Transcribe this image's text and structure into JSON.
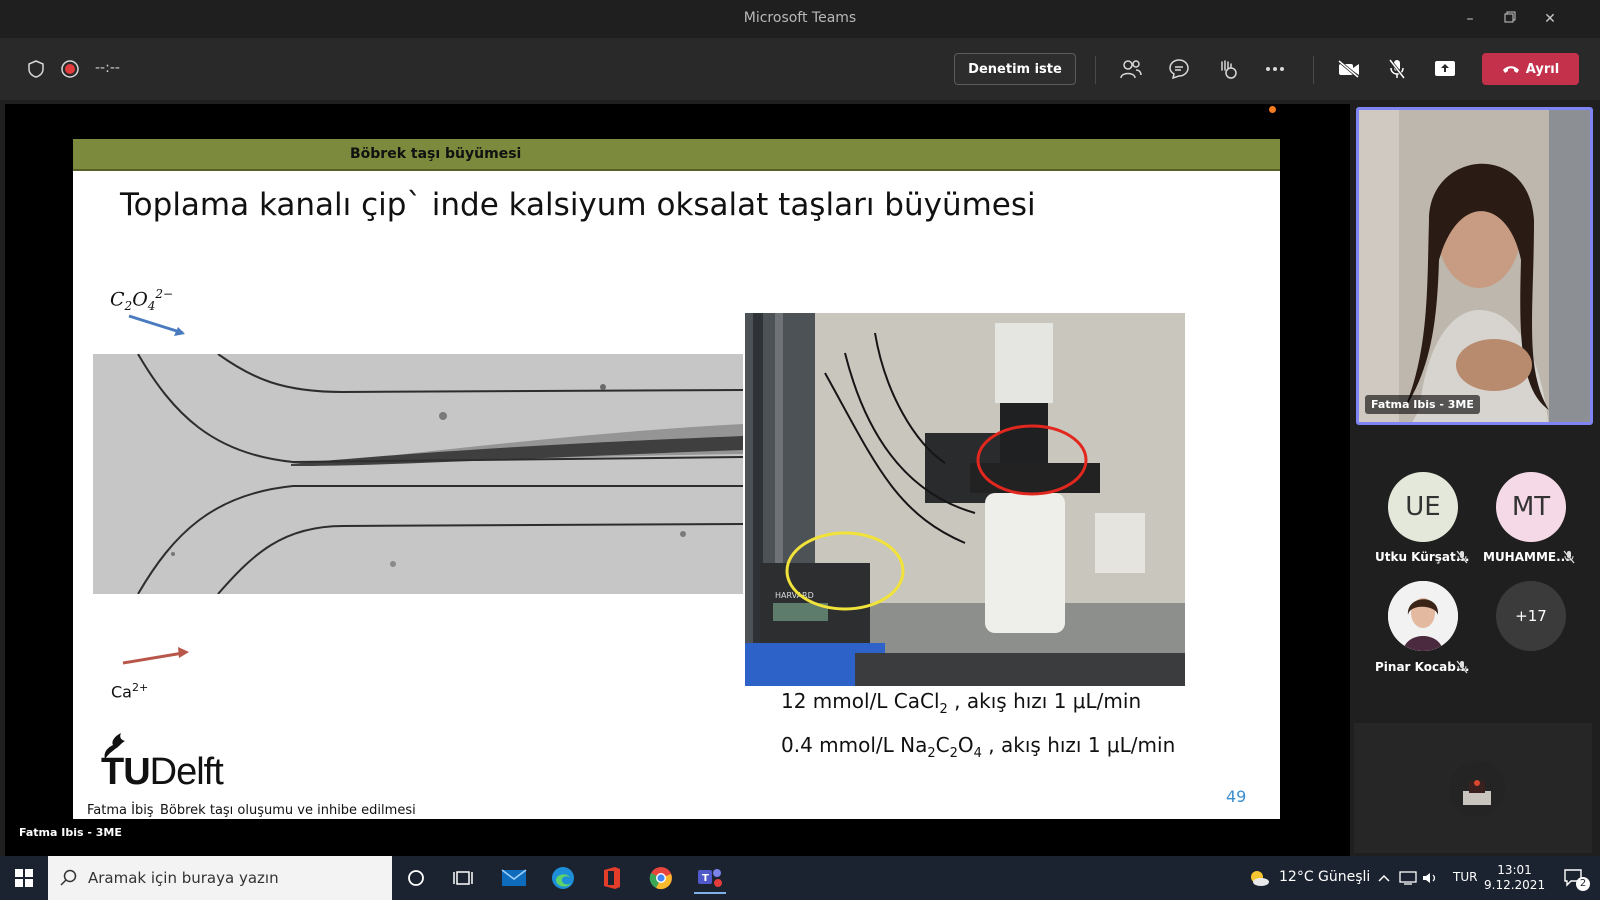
{
  "window": {
    "title": "Microsoft Teams"
  },
  "toolbar": {
    "timer": "--:--",
    "control_label": "Denetim iste",
    "leave_label": "Ayrıl"
  },
  "stage": {
    "presenter_label": "Fatma Ibis - 3ME"
  },
  "slide": {
    "header": "Böbrek taşı büyümesi",
    "title": "Toplama kanalı çip` inde kalsiyum oksalat taşları büyümesi",
    "ion_top": {
      "base": "C",
      "sub1": "2",
      "mid": "O",
      "sub2": "4",
      "sup": "2−"
    },
    "ion_bottom": {
      "base": "Ca",
      "sup": "2+"
    },
    "condition1": {
      "pre": "12 mmol/L CaCl",
      "sub": "2",
      "post": " , akış hızı 1 μL/min"
    },
    "condition2": {
      "pre": "0.4 mmol/L Na",
      "sub1": "2",
      "mid1": "C",
      "sub2": "2",
      "mid2": "O",
      "sub3": "4",
      "post": " , akış hızı 1 μL/min"
    },
    "page_number": "49",
    "logo": {
      "tu": "TU",
      "delft": "Delft"
    },
    "footer_author": "Fatma İbiş",
    "footer_topic": "Böbrek taşı oluşumu ve inhibe edilmesi",
    "photo_device_label": "HARVARD"
  },
  "participants": {
    "selfview_name": "Fatma Ibis - 3ME",
    "people": [
      {
        "initials": "UE",
        "name": "Utku Kürşat...",
        "color": "#e3e8da"
      },
      {
        "initials": "MT",
        "name": "MUHAMME...",
        "color": "#f6d9e6"
      },
      {
        "initials": "",
        "name": "Pinar Kocab...",
        "color": "#ffffff"
      }
    ],
    "more_count": "+17"
  },
  "taskbar": {
    "search_placeholder": "Aramak için buraya yazın",
    "weather": "12°C  Güneşli",
    "language": "TUR",
    "time": "13:01",
    "date": "9.12.2021",
    "notifications": "2"
  }
}
